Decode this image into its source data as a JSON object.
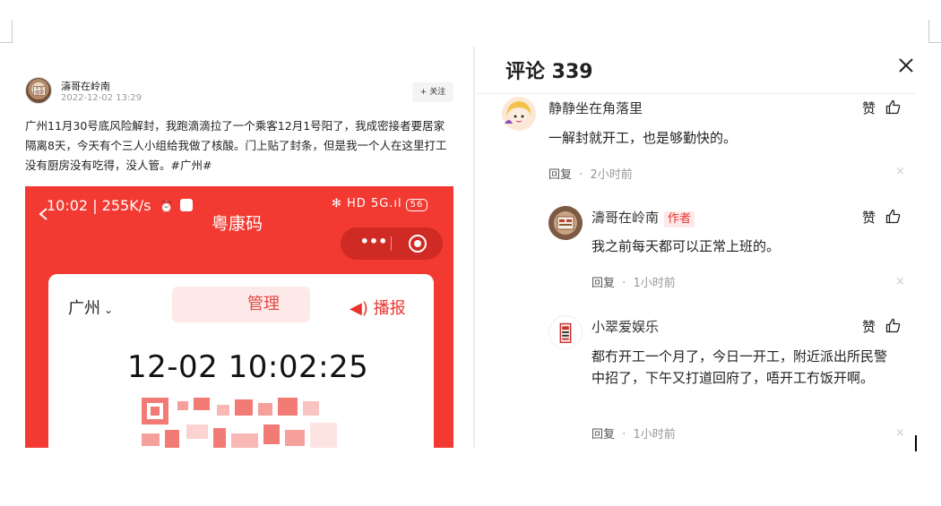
{
  "post": {
    "author": "濤哥在岭南",
    "time": "2022-12-02 13:29",
    "follow_label": "+ 关注",
    "avatar_label": "平安 健康",
    "text": "广州11月30号底风险解封，我跑滴滴拉了一个乘客12月1号阳了，我成密接者要居家隔离8天，今天有个三人小组给我做了核酸。门上贴了封条，但是我一个人在这里打工没有厨房没有吃得，没人管。#广州#"
  },
  "phone_screen": {
    "status_time": "10:02 | 255K/s",
    "status_icons": "✻ HD 5G.ıl",
    "battery": "56",
    "app_title": "粤康码",
    "capsule_dots": "•••",
    "city": "广州",
    "manage_label": "管理",
    "broadcast_label": "播报",
    "datetime": "12-02 10:02:25"
  },
  "comments_panel": {
    "title": "评论 339",
    "items": [
      {
        "name": "静静坐在角落里",
        "like": "赞",
        "text": "一解封就开工，也是够勤快的。",
        "reply": "回复",
        "time": "2小时前"
      },
      {
        "name": "濤哥在岭南",
        "tag": "作者",
        "like": "赞",
        "text": "我之前每天都可以正常上班的。",
        "reply": "回复",
        "time": "1小时前"
      },
      {
        "name": "小翠爱娱乐",
        "like": "赞",
        "text": "都冇开工一个月了，今日一开工，附近派出所民警中招了，下午又打道回府了，唔开工冇饭开啊。",
        "reply": "回复",
        "time": "1小时前"
      }
    ],
    "separator": "·",
    "dismiss": "×"
  },
  "colors": {
    "accent_red": "#f23a32",
    "author_tag": "#e9342e"
  }
}
